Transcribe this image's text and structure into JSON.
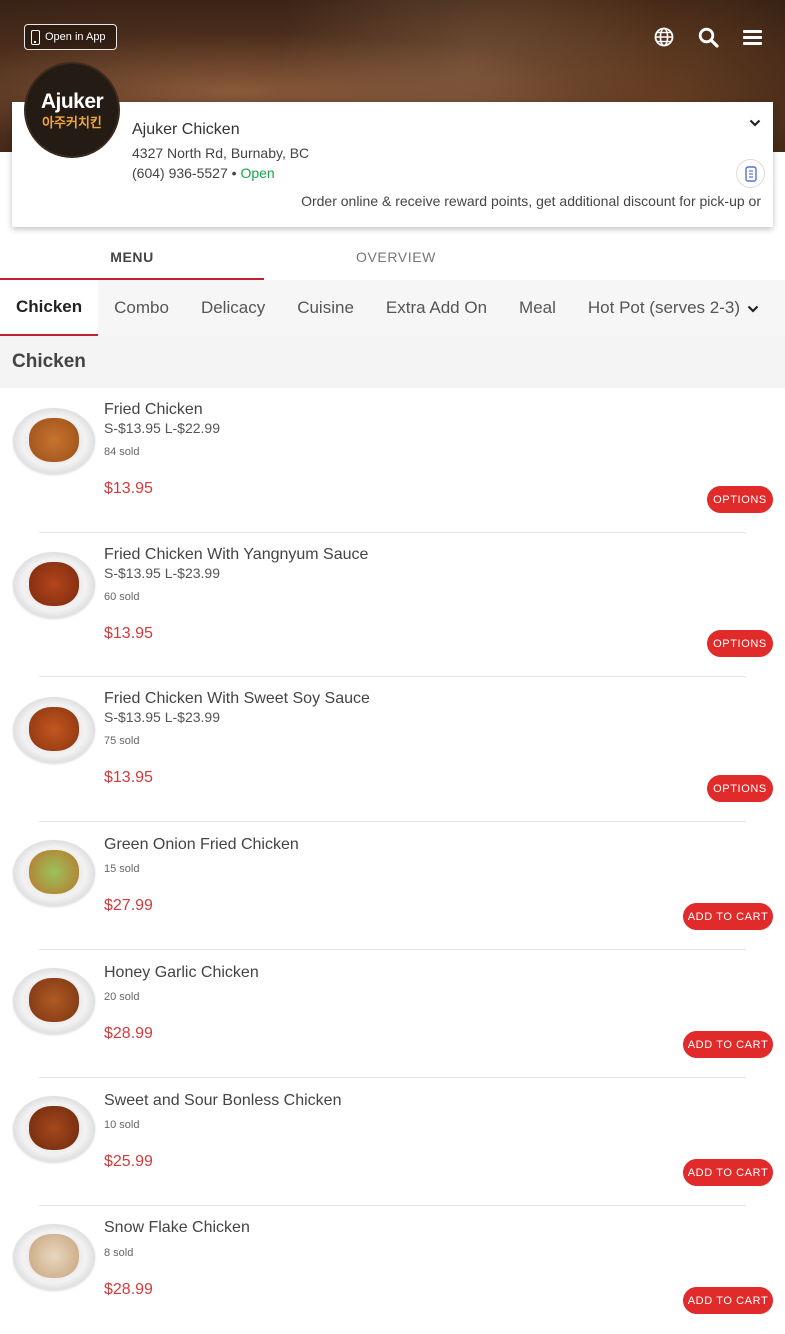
{
  "header": {
    "open_app_label": "Open in App",
    "icons": [
      "globe-icon",
      "search-icon",
      "menu-icon"
    ]
  },
  "store": {
    "logo_text": "Ajuker",
    "logo_subtext": "아주커치킨",
    "name": "Ajuker Chicken",
    "address": "4327 North Rd, Burnaby, BC",
    "phone": "(604) 936-5527",
    "separator": "•",
    "status": "Open",
    "promo": "Order online & receive reward points, get additional discount for pick-up or"
  },
  "tabs": [
    {
      "label": "MENU",
      "active": true
    },
    {
      "label": "OVERVIEW",
      "active": false
    }
  ],
  "categories": [
    {
      "label": "Chicken",
      "active": true
    },
    {
      "label": "Combo"
    },
    {
      "label": "Delicacy"
    },
    {
      "label": "Cuisine"
    },
    {
      "label": "Extra Add On"
    },
    {
      "label": "Meal"
    },
    {
      "label": "Hot Pot (serves 2-3)"
    }
  ],
  "section_title": "Chicken",
  "items": [
    {
      "name": "Fried Chicken",
      "desc": "S-$13.95 L-$22.99",
      "sold": "84 sold",
      "price": "$13.95",
      "button": "OPTIONS"
    },
    {
      "name": "Fried Chicken With Yangnyum Sauce",
      "desc": "S-$13.95 L-$23.99",
      "sold": "60 sold",
      "price": "$13.95",
      "button": "OPTIONS"
    },
    {
      "name": "Fried Chicken With Sweet Soy Sauce",
      "desc": "S-$13.95 L-$23.99",
      "sold": "75 sold",
      "price": "$13.95",
      "button": "OPTIONS"
    },
    {
      "name": "Green Onion Fried Chicken",
      "desc": "",
      "sold": "15 sold",
      "price": "$27.99",
      "button": "ADD TO CART"
    },
    {
      "name": "Honey Garlic Chicken",
      "desc": "",
      "sold": "20 sold",
      "price": "$28.99",
      "button": "ADD TO CART"
    },
    {
      "name": "Sweet and Sour Bonless Chicken",
      "desc": "",
      "sold": "10 sold",
      "price": "$25.99",
      "button": "ADD TO CART"
    },
    {
      "name": "Snow Flake Chicken",
      "desc": "",
      "sold": "8 sold",
      "price": "$28.99",
      "button": "ADD TO CART"
    }
  ],
  "colors": {
    "accent": "#e12b2b",
    "price": "#d23b3b",
    "open_status": "#18a34a",
    "active_underline": "#c22332"
  }
}
